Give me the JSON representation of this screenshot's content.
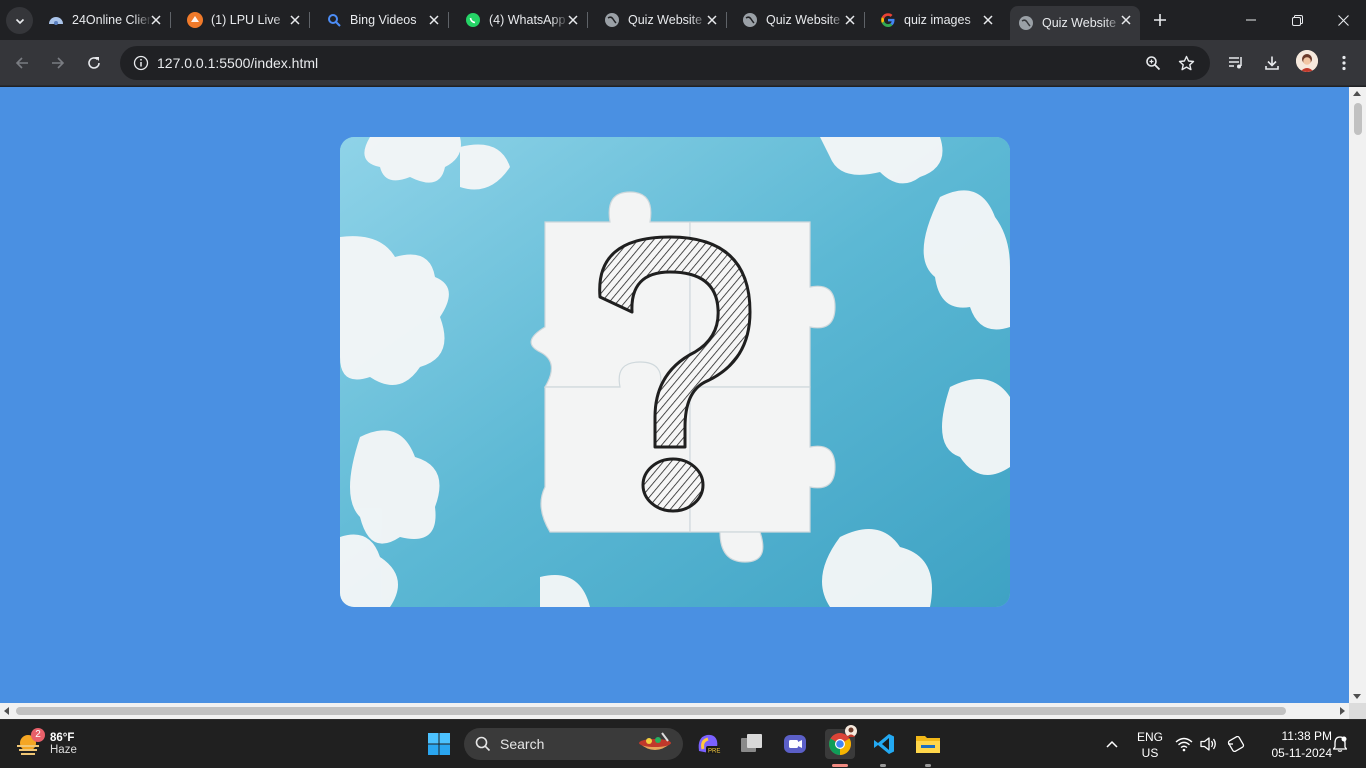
{
  "tabs": [
    {
      "title": "24Online Client",
      "icon": "24online-icon"
    },
    {
      "title": "(1) LPU Live",
      "icon": "lpu-live-icon"
    },
    {
      "title": "Bing Videos",
      "icon": "bing-search-icon"
    },
    {
      "title": "(4) WhatsApp",
      "icon": "whatsapp-icon"
    },
    {
      "title": "Quiz Website",
      "icon": "globe-icon"
    },
    {
      "title": "Quiz Website",
      "icon": "globe-icon"
    },
    {
      "title": "quiz images",
      "icon": "google-icon"
    },
    {
      "title": "Quiz Website",
      "icon": "globe-icon",
      "active": true
    }
  ],
  "address_bar": {
    "url": "127.0.0.1:5500/index.html"
  },
  "page": {
    "background_color": "#4a90e2",
    "image": {
      "description_icon": "puzzle-question-mark-image"
    }
  },
  "taskbar": {
    "weather": {
      "temperature": "86°F",
      "condition": "Haze",
      "badge_count": "2"
    },
    "search_label": "Search",
    "language": "ENG",
    "region": "US",
    "time": "11:38 PM",
    "date": "05-11-2024"
  }
}
